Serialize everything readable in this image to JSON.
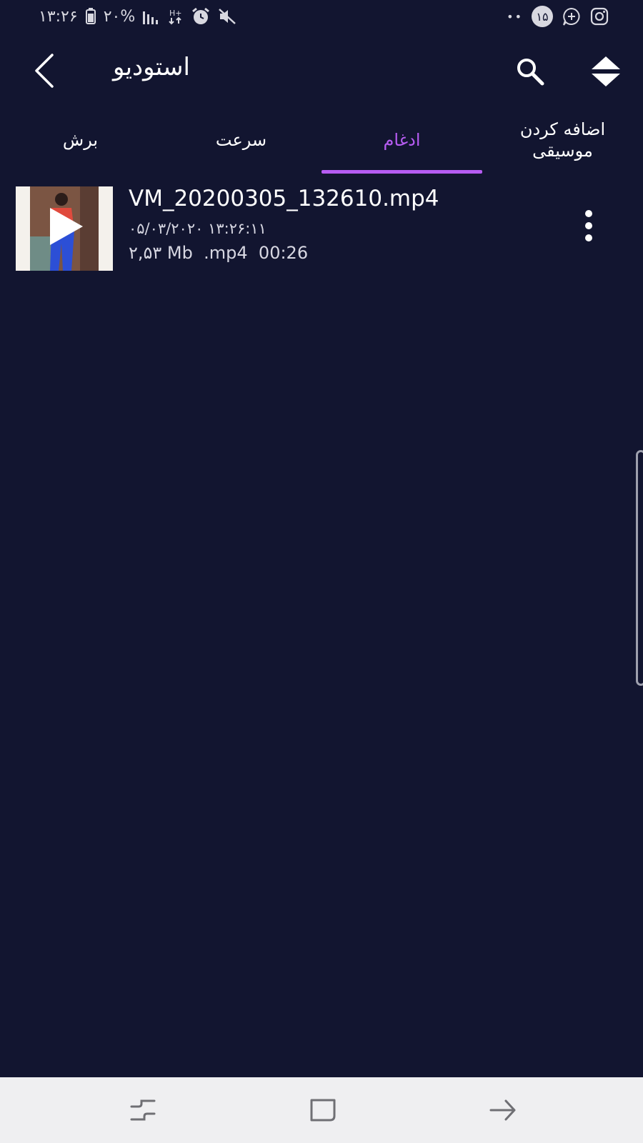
{
  "status_bar": {
    "time": "۱۳:۲۶",
    "battery": "۲۰%",
    "notif_count": "۱۵",
    "dots": "••"
  },
  "toolbar": {
    "title": "استودیو"
  },
  "tabs": [
    {
      "label": "برش",
      "active": false
    },
    {
      "label": "سرعت",
      "active": false
    },
    {
      "label": "ادغام",
      "active": true
    },
    {
      "label": "اضافه کردن\nموسیقی",
      "active": false
    }
  ],
  "files": [
    {
      "name": "VM_20200305_132610.mp4",
      "date": "۰۵/۰۳/۲۰۲۰ ۱۳:۲۶:۱۱",
      "size": "۲,۵۳ Mb",
      "ext": ".mp4",
      "duration": "00:26"
    }
  ],
  "colors": {
    "background": "#121530",
    "accent": "#b65cf2",
    "navbar": "#efeff1"
  },
  "icons": {
    "back": "chevron-left-icon",
    "search": "search-icon",
    "sort": "sort-icon",
    "play": "play-icon",
    "more": "more-vertical-icon"
  }
}
